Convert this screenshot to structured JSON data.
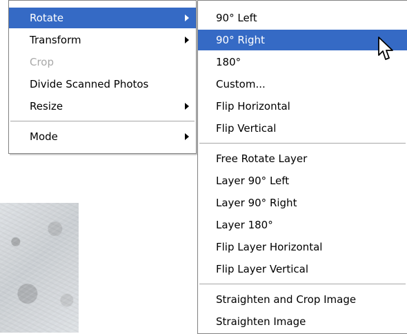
{
  "menus": {
    "main": {
      "items": [
        {
          "label": "Rotate",
          "has_submenu": true,
          "state": "highlighted"
        },
        {
          "label": "Transform",
          "has_submenu": true,
          "state": "normal"
        },
        {
          "label": "Crop",
          "has_submenu": false,
          "state": "disabled"
        },
        {
          "label": "Divide Scanned Photos",
          "has_submenu": false,
          "state": "normal"
        },
        {
          "label": "Resize",
          "has_submenu": true,
          "state": "normal"
        },
        {
          "label": "Mode",
          "has_submenu": true,
          "state": "normal"
        }
      ]
    },
    "submenu": {
      "items": [
        {
          "label": "90° Left",
          "state": "normal"
        },
        {
          "label": "90° Right",
          "state": "highlighted"
        },
        {
          "label": "180°",
          "state": "normal"
        },
        {
          "label": "Custom...",
          "state": "normal"
        },
        {
          "label": "Flip Horizontal",
          "state": "normal"
        },
        {
          "label": "Flip Vertical",
          "state": "normal"
        },
        {
          "label": "Free Rotate Layer",
          "state": "normal"
        },
        {
          "label": "Layer 90° Left",
          "state": "normal"
        },
        {
          "label": "Layer 90° Right",
          "state": "normal"
        },
        {
          "label": "Layer 180°",
          "state": "normal"
        },
        {
          "label": "Flip Layer Horizontal",
          "state": "normal"
        },
        {
          "label": "Flip Layer Vertical",
          "state": "normal"
        },
        {
          "label": "Straighten and Crop Image",
          "state": "normal"
        },
        {
          "label": "Straighten Image",
          "state": "normal"
        }
      ]
    }
  },
  "icons": {
    "submenu_arrow": "submenu-arrow-icon",
    "cursor": "mouse-pointer-icon"
  },
  "colors": {
    "highlight": "#356ac5",
    "highlight_text": "#ffffff",
    "disabled_text": "#a8a8a8",
    "menu_border": "#808080",
    "separator": "#a6a6a6"
  }
}
